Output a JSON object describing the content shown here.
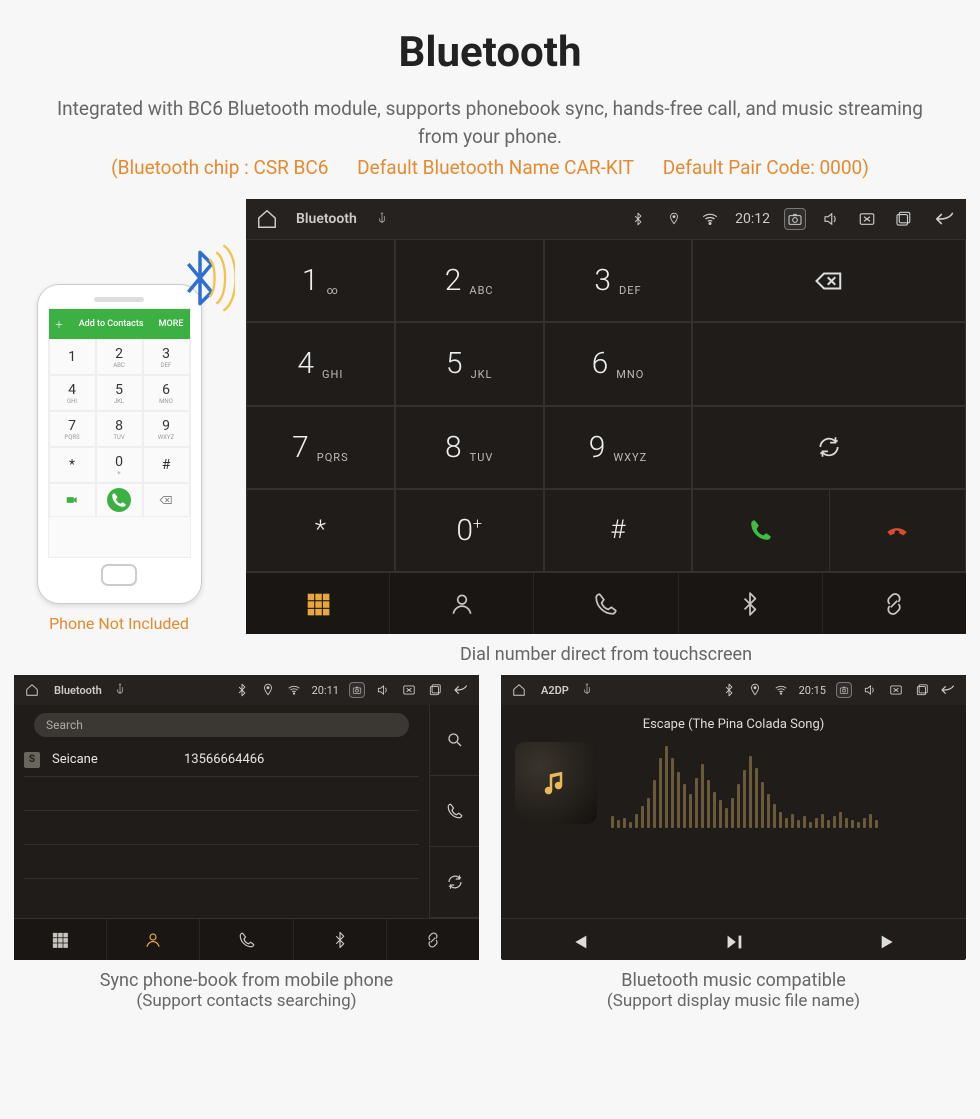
{
  "page": {
    "title": "Bluetooth",
    "description": "Integrated with BC6 Bluetooth module, supports phonebook sync, hands-free call, and music streaming from your phone.",
    "spec_chip": "(Bluetooth chip : CSR BC6",
    "spec_name": "Default Bluetooth Name CAR-KIT",
    "spec_code": "Default Pair Code: 0000)"
  },
  "phone": {
    "topbar": "Add to Contacts",
    "topbar_more": "MORE",
    "keys": [
      {
        "n": "1",
        "l": ""
      },
      {
        "n": "2",
        "l": "ABC"
      },
      {
        "n": "3",
        "l": "DEF"
      },
      {
        "n": "4",
        "l": "GHI"
      },
      {
        "n": "5",
        "l": "JKL"
      },
      {
        "n": "6",
        "l": "MNO"
      },
      {
        "n": "7",
        "l": "PQRS"
      },
      {
        "n": "8",
        "l": "TUV"
      },
      {
        "n": "9",
        "l": "WXYZ"
      },
      {
        "n": "*",
        "l": ""
      },
      {
        "n": "0",
        "l": "+"
      },
      {
        "n": "#",
        "l": ""
      }
    ],
    "caption": "Phone Not Included"
  },
  "dialer": {
    "status": {
      "title": "Bluetooth",
      "time": "20:12"
    },
    "keys": [
      {
        "n": "1",
        "l": "∞"
      },
      {
        "n": "2",
        "l": "ABC"
      },
      {
        "n": "3",
        "l": "DEF"
      },
      {
        "n": "4",
        "l": "GHI"
      },
      {
        "n": "5",
        "l": "JKL"
      },
      {
        "n": "6",
        "l": "MNO"
      },
      {
        "n": "7",
        "l": "PQRS"
      },
      {
        "n": "8",
        "l": "TUV"
      },
      {
        "n": "9",
        "l": "WXYZ"
      },
      {
        "n": "*",
        "l": ""
      },
      {
        "n": "0",
        "l": "+"
      },
      {
        "n": "#",
        "l": ""
      }
    ],
    "caption": "Dial number direct from touchscreen"
  },
  "phonebook": {
    "status": {
      "title": "Bluetooth",
      "time": "20:11"
    },
    "search_placeholder": "Search",
    "contact": {
      "initial": "S",
      "name": "Seicane",
      "number": "13566664466"
    },
    "caption_line1": "Sync phone-book from mobile phone",
    "caption_line2": "(Support contacts searching)"
  },
  "a2dp": {
    "status": {
      "title": "A2DP",
      "time": "20:15"
    },
    "track": "Escape (The Pina Colada Song)",
    "caption_line1": "Bluetooth music compatible",
    "caption_line2": "(Support display music file name)"
  }
}
